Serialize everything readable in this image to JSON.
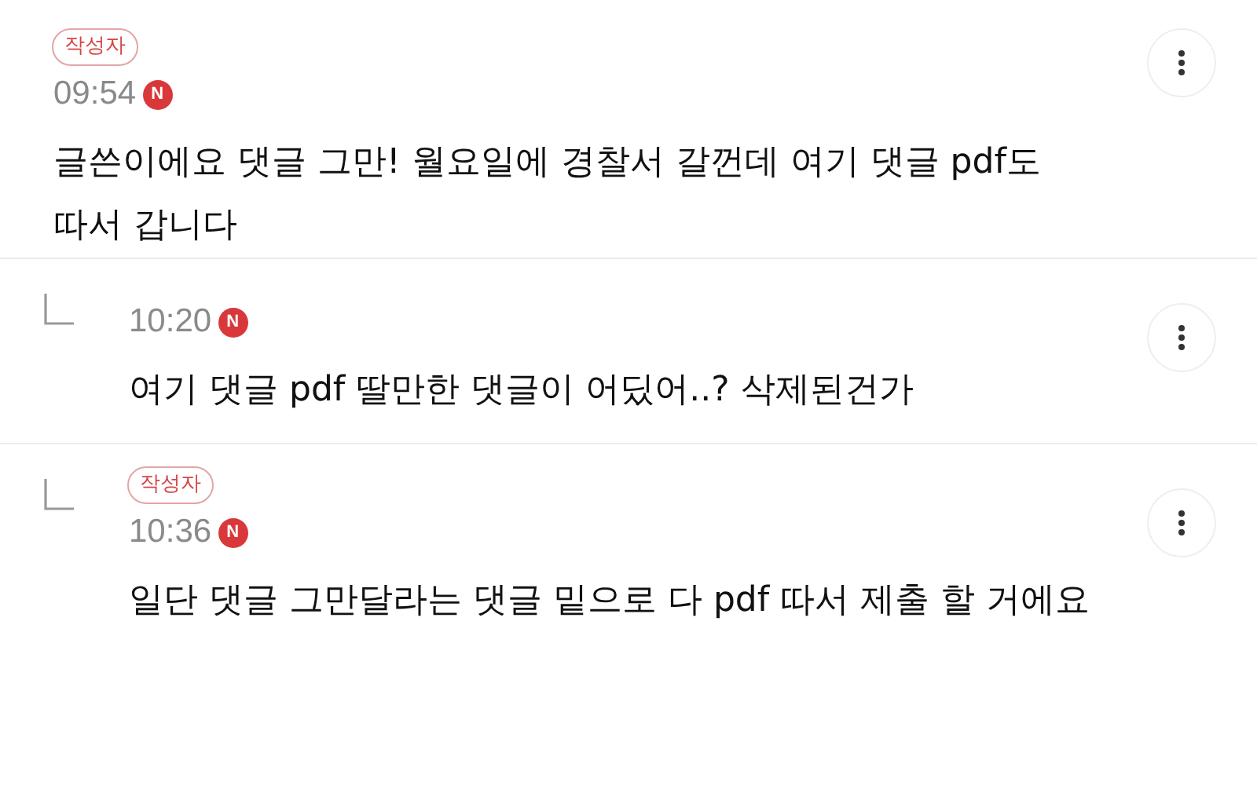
{
  "comments": [
    {
      "kind": "comment",
      "author_badge": "작성자",
      "time": "09:54",
      "new_badge": "N",
      "text": "글쓴이에요 댓글 그만! 월요일에 경찰서 갈껀데 여기 댓글 pdf도 따서 갑니다"
    },
    {
      "kind": "reply",
      "time": "10:20",
      "new_badge": "N",
      "text": "여기 댓글 pdf 딸만한 댓글이 어딨어..? 삭제된건가"
    },
    {
      "kind": "reply",
      "author_badge": "작성자",
      "time": "10:36",
      "new_badge": "N",
      "text": "일단 댓글 그만달라는 댓글 밑으로 다 pdf 따서 제출 할 거에요"
    }
  ]
}
